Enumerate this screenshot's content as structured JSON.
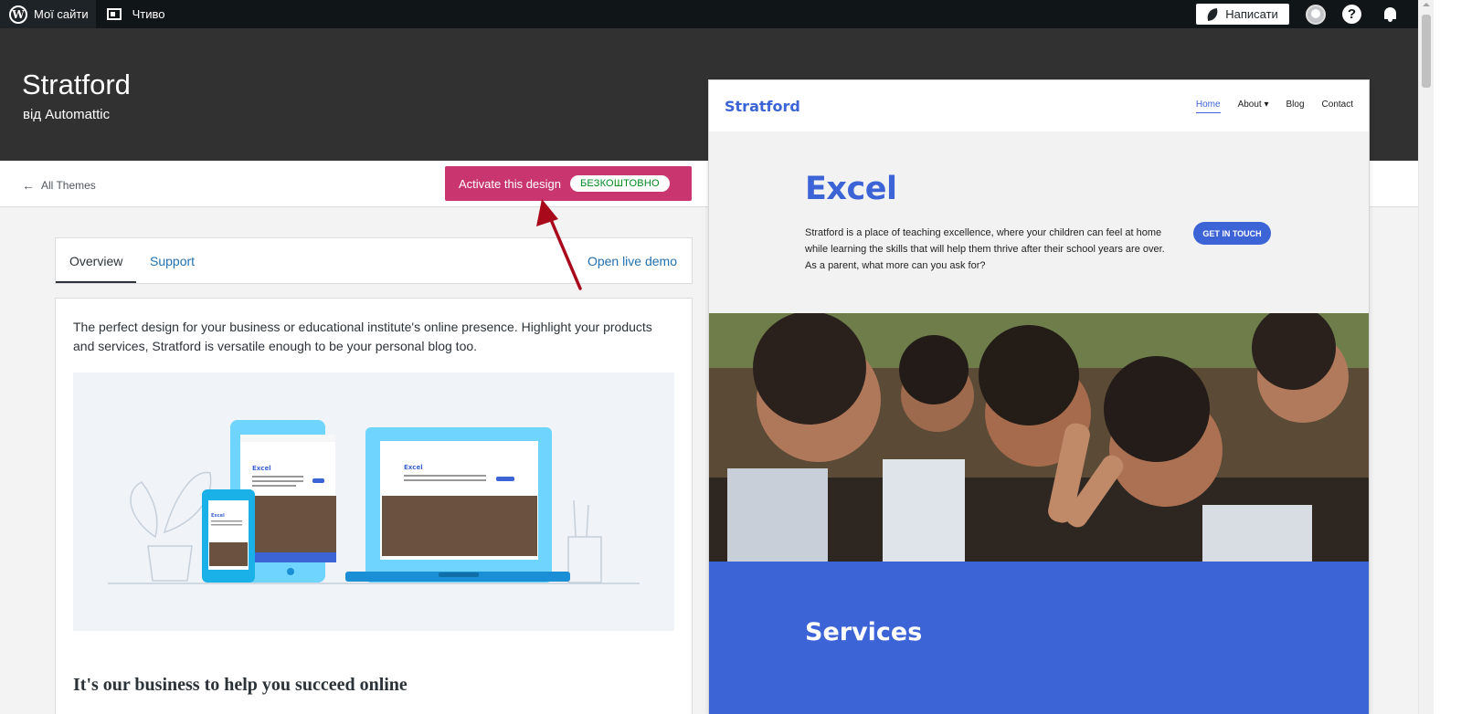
{
  "admin_bar": {
    "my_sites": "Мої сайти",
    "reader": "Чтиво",
    "write": "Написати"
  },
  "theme": {
    "name": "Stratford",
    "author": "від Automattic"
  },
  "actions": {
    "back": "All Themes",
    "activate": "Activate this design",
    "price_badge": "БЕЗКОШТОВНО"
  },
  "tabs": {
    "overview": "Overview",
    "support": "Support",
    "live_demo": "Open live demo"
  },
  "content": {
    "description": "The perfect design for your business or educational institute's online presence. Highlight your products and services, Stratford is versatile enough to be your personal blog too.",
    "heading": "It's our business to help you succeed online"
  },
  "preview": {
    "logo": "Stratford",
    "menu": [
      "Home",
      "About ▾",
      "Blog",
      "Contact"
    ],
    "hero_title": "Excel",
    "hero_text": "Stratford is a place of teaching excellence, where your children can feel at home while learning the skills that will help them thrive after their school years are over. As a parent, what more can you ask for?",
    "cta": "GET IN TOUCH",
    "services_title": "Services"
  },
  "colors": {
    "accent": "#c9356e",
    "preview_blue": "#3c64d6",
    "free_green": "#008a20",
    "header_dark": "#313131"
  }
}
